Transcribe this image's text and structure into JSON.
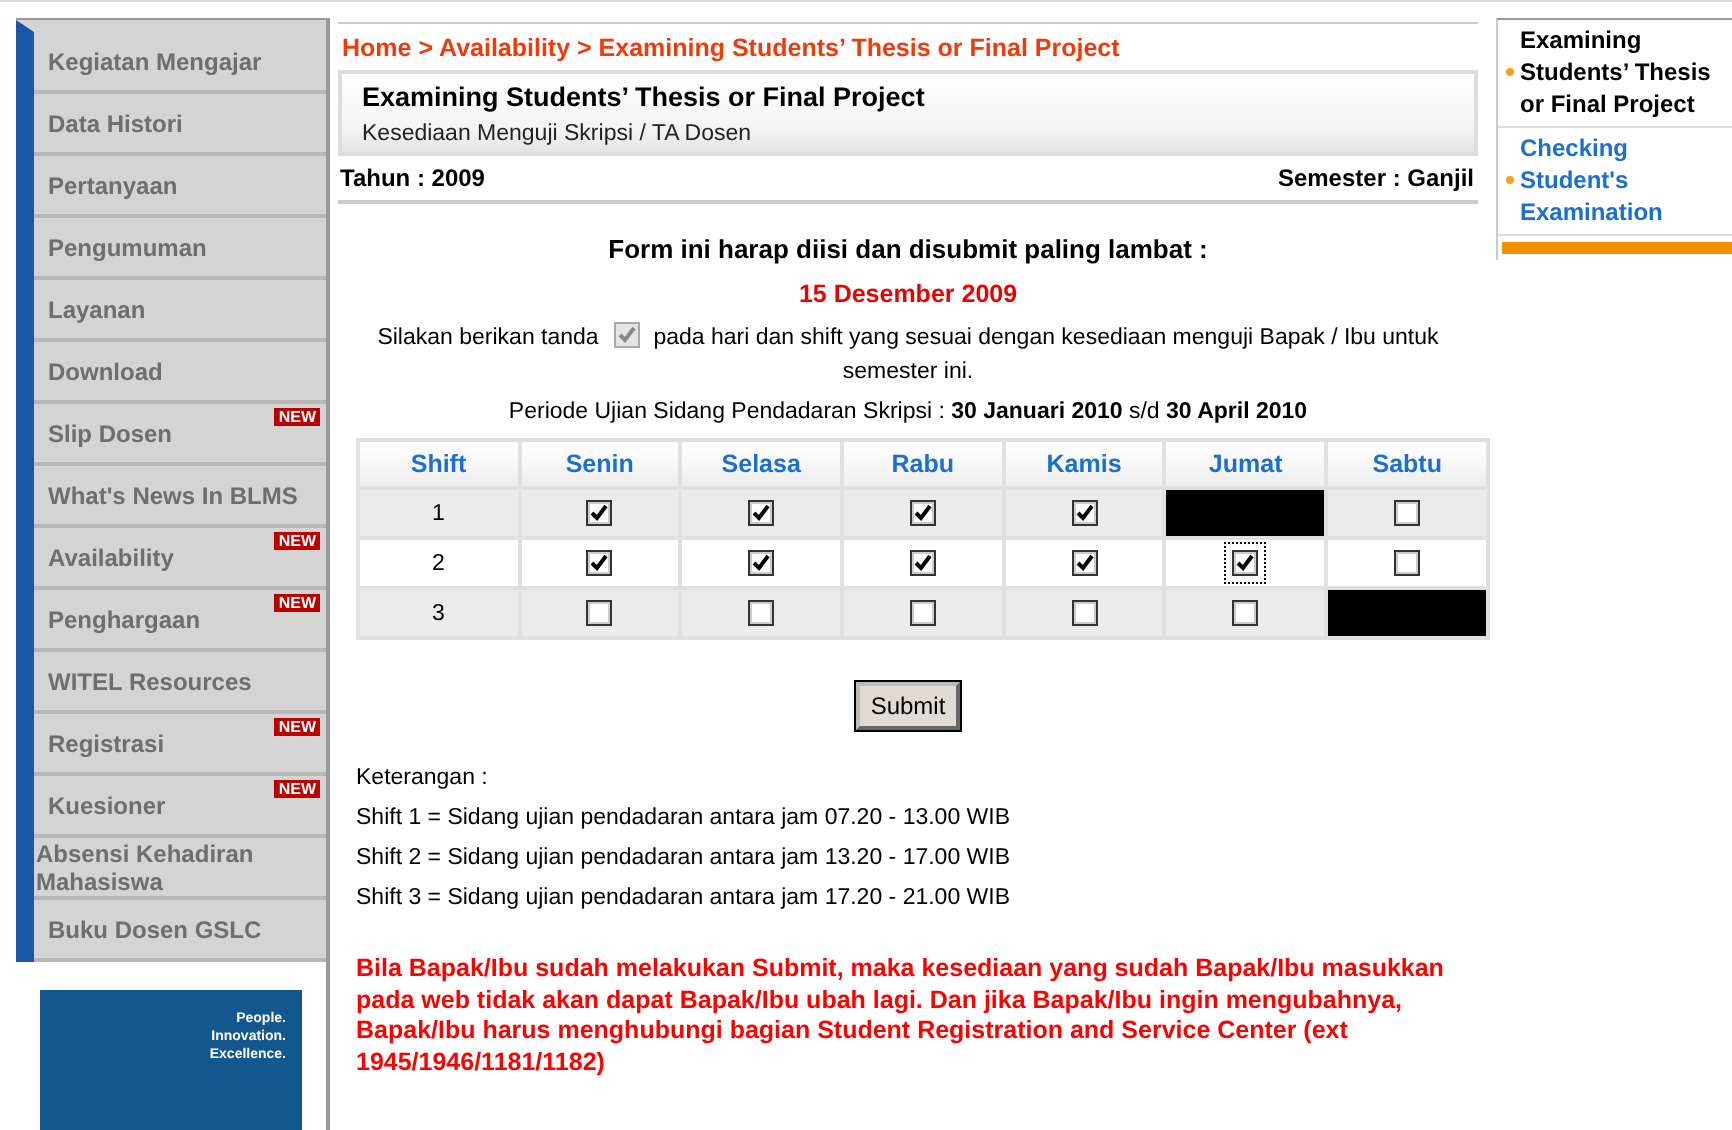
{
  "sidebar": {
    "items": [
      {
        "label": "Kegiatan Mengajar"
      },
      {
        "label": "Data Histori"
      },
      {
        "label": "Pertanyaan"
      },
      {
        "label": "Pengumuman"
      },
      {
        "label": "Layanan"
      },
      {
        "label": "Download"
      },
      {
        "label": "Slip Dosen",
        "badge": "NEW"
      },
      {
        "label": "What's News In BLMS"
      },
      {
        "label": "Availability",
        "badge": "NEW"
      },
      {
        "label": "Penghargaan",
        "badge": "NEW"
      },
      {
        "label": "WITEL Resources"
      },
      {
        "label": "Registrasi",
        "badge": "NEW"
      },
      {
        "label": "Kuesioner",
        "badge": "NEW"
      },
      {
        "label": "Absensi Kehadiran Mahasiswa"
      },
      {
        "label": "Buku Dosen GSLC"
      }
    ],
    "logo": {
      "lines": [
        "People.",
        "Innovation.",
        "Excellence."
      ]
    }
  },
  "breadcrumb": "Home > Availability > Examining Students’ Thesis or Final Project",
  "header": {
    "title": "Examining Students’ Thesis or Final Project",
    "subtitle": "Kesediaan Menguji Skripsi / TA Dosen"
  },
  "tahun": "Tahun : 2009",
  "semester": "Semester : Ganjil",
  "form": {
    "deadline_label": "Form ini harap diisi dan disubmit paling lambat :",
    "deadline": "15 Desember 2009",
    "instruction_before": "Silakan berikan tanda",
    "instruction_after": "pada hari dan shift yang sesuai dengan kesediaan menguji Bapak / Ibu untuk semester ini.",
    "periode": "Periode Ujian Sidang Pendadaran Skripsi : **30 Januari 2010** s/d **30 April 2010**"
  },
  "table": {
    "columns": [
      "Shift",
      "Senin",
      "Selasa",
      "Rabu",
      "Kamis",
      "Jumat",
      "Sabtu"
    ],
    "rows": [
      {
        "shift": "1",
        "cells": [
          {
            "kind": "checkbox",
            "checked": true,
            "focused": false
          },
          {
            "kind": "checkbox",
            "checked": true,
            "focused": false
          },
          {
            "kind": "checkbox",
            "checked": true,
            "focused": false
          },
          {
            "kind": "checkbox",
            "checked": true,
            "focused": false
          },
          {
            "kind": "blocked"
          },
          {
            "kind": "checkbox",
            "checked": false,
            "focused": false
          }
        ]
      },
      {
        "shift": "2",
        "cells": [
          {
            "kind": "checkbox",
            "checked": true,
            "focused": false
          },
          {
            "kind": "checkbox",
            "checked": true,
            "focused": false
          },
          {
            "kind": "checkbox",
            "checked": true,
            "focused": false
          },
          {
            "kind": "checkbox",
            "checked": true,
            "focused": false
          },
          {
            "kind": "checkbox",
            "checked": true,
            "focused": true
          },
          {
            "kind": "checkbox",
            "checked": false,
            "focused": false
          }
        ]
      },
      {
        "shift": "3",
        "cells": [
          {
            "kind": "checkbox",
            "checked": false,
            "focused": false
          },
          {
            "kind": "checkbox",
            "checked": false,
            "focused": false
          },
          {
            "kind": "checkbox",
            "checked": false,
            "focused": false
          },
          {
            "kind": "checkbox",
            "checked": false,
            "focused": false
          },
          {
            "kind": "checkbox",
            "checked": false,
            "focused": false
          },
          {
            "kind": "blocked"
          }
        ]
      }
    ]
  },
  "submit": "Submit",
  "keterangan": {
    "title": "Keterangan :",
    "lines": [
      "Shift 1 = Sidang ujian pendadaran antara jam 07.20 - 13.00 WIB",
      "Shift 2 = Sidang ujian pendadaran antara jam 13.20 - 17.00 WIB",
      "Shift 3 = Sidang ujian pendadaran antara jam 17.20 - 21.00 WIB"
    ]
  },
  "warning": "Bila Bapak/Ibu sudah melakukan Submit, maka kesediaan yang sudah Bapak/Ibu masukkan pada web tidak akan dapat Bapak/Ibu ubah lagi. Dan jika Bapak/Ibu ingin mengubahnya, Bapak/Ibu harus menghubungi bagian Student Registration and Service Center (ext 1945/1946/1181/1182)",
  "right_menu": {
    "items": [
      {
        "label": "Examining Students’ Thesis or Final Project",
        "selected": true
      },
      {
        "label": "Checking Student's Examination",
        "selected": false
      }
    ]
  }
}
